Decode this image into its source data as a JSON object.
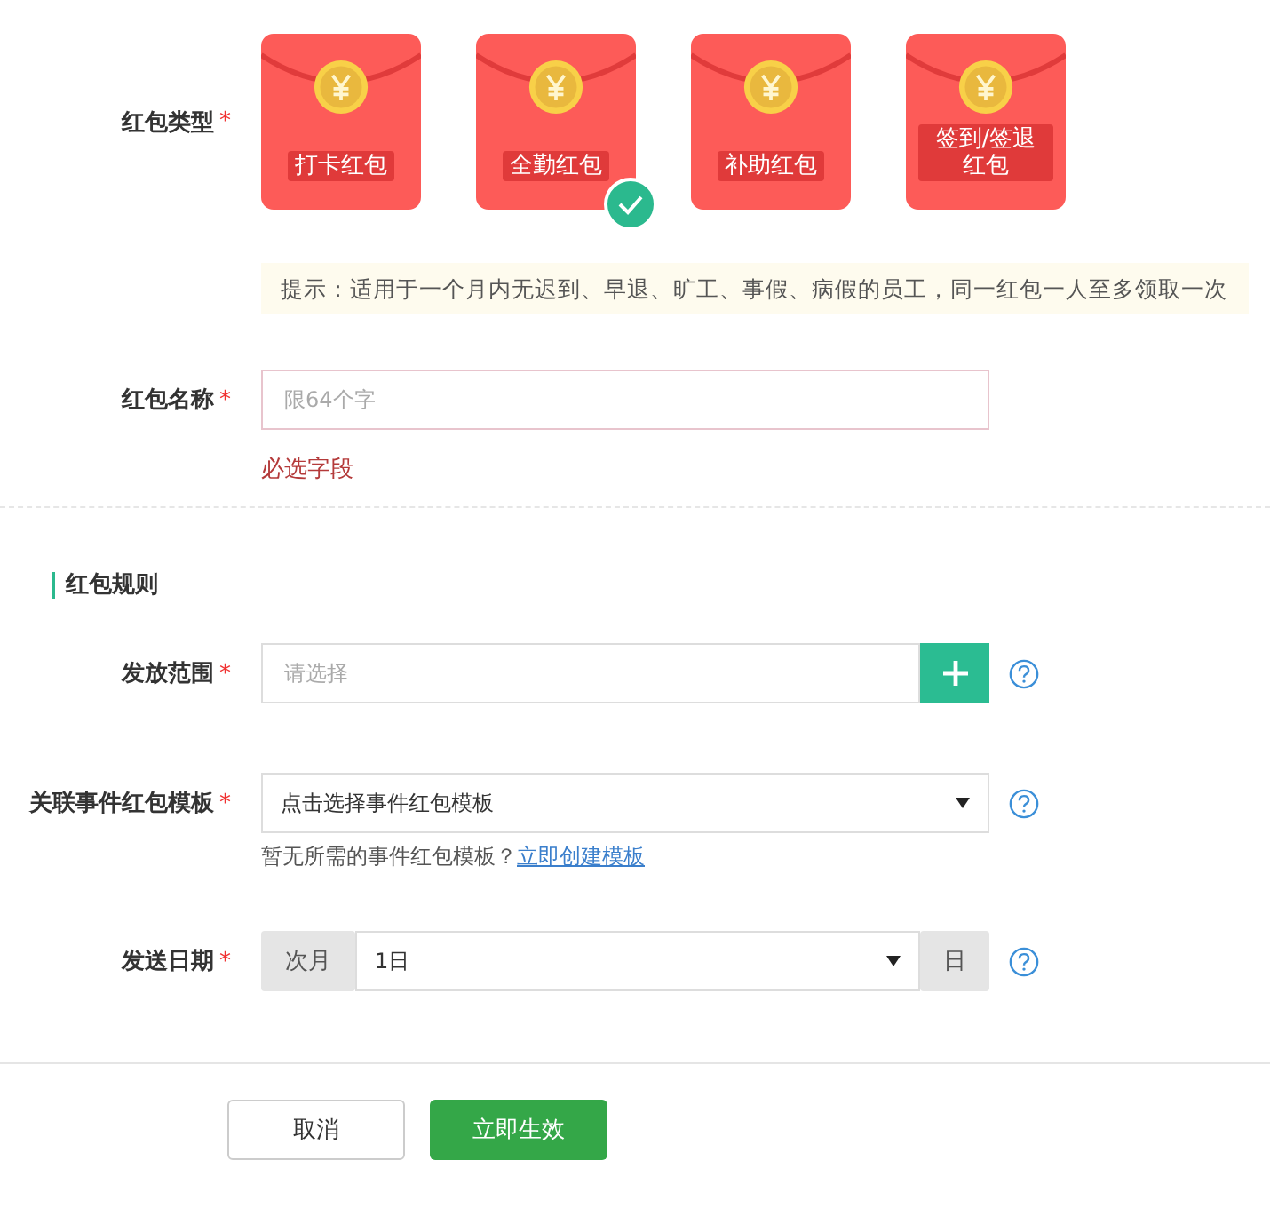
{
  "type_field": {
    "label": "红包类型",
    "required_mark": "*",
    "options": [
      {
        "label": "打卡红包",
        "selected": false
      },
      {
        "label": "全勤红包",
        "selected": true
      },
      {
        "label": "补助红包",
        "selected": false
      },
      {
        "label": "签到/签退红包",
        "selected": false
      }
    ],
    "tip": "提示：适用于一个月内无迟到、早退、旷工、事假、病假的员工，同一红包一人至多领取一次"
  },
  "name_field": {
    "label": "红包名称",
    "required_mark": "*",
    "placeholder": "限64个字",
    "error": "必选字段"
  },
  "section_title": "红包规则",
  "range_field": {
    "label": "发放范围",
    "required_mark": "*",
    "placeholder": "请选择"
  },
  "template_field": {
    "label": "关联事件红包模板",
    "required_mark": "*",
    "value": "点击选择事件红包模板",
    "hint": "暂无所需的事件红包模板？",
    "link": "立即创建模板"
  },
  "date_field": {
    "label": "发送日期",
    "required_mark": "*",
    "prefix": "次月",
    "value": "1日",
    "suffix": "日"
  },
  "buttons": {
    "cancel": "取消",
    "submit": "立即生效"
  }
}
